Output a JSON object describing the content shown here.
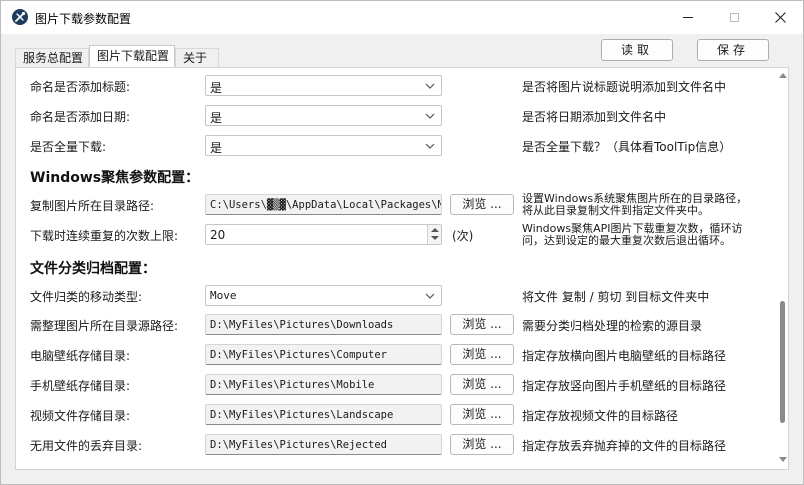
{
  "window": {
    "title": "图片下载参数配置"
  },
  "tabs": [
    {
      "label": "服务总配置"
    },
    {
      "label": "图片下载配置"
    },
    {
      "label": "关于"
    }
  ],
  "actions": {
    "read_label": "读取",
    "save_label": "保存"
  },
  "general": {
    "rows": [
      {
        "label": "命名是否添加标题:",
        "value": "是",
        "desc": "是否将图片说标题说明添加到文件名中"
      },
      {
        "label": "命名是否添加日期:",
        "value": "是",
        "desc": "是否将日期添加到文件名中"
      },
      {
        "label": "是否全量下载:",
        "value": "是",
        "desc": "是否全量下载？（具体看ToolTip信息）"
      }
    ]
  },
  "windows_section": {
    "title": "Windows聚焦参数配置：",
    "copy_path": {
      "label": "复制图片所在目录路径:",
      "value": "C:\\Users\\▓▒▓\\AppData\\Local\\Packages\\Mic",
      "browse": "浏览 ...",
      "desc_line1": "设置Windows系统聚焦图片所在的目录路径，",
      "desc_line2": "将从此目录复制文件到指定文件夹中。"
    },
    "repeat_limit": {
      "label": "下载时连续重复的次数上限:",
      "value": "20",
      "unit": "(次)",
      "desc_line1": "Windows聚焦API图片下载重复次数，循环访",
      "desc_line2": "问，达到设定的最大重复次数后退出循环。"
    }
  },
  "archive_section": {
    "title": "文件分类归档配置：",
    "move_type": {
      "label": "文件归类的移动类型:",
      "value": "Move",
      "desc": "将文件 复制 / 剪切 到目标文件夹中"
    },
    "paths": [
      {
        "label": "需整理图片所在目录源路径:",
        "value": "D:\\MyFiles\\Pictures\\Downloads",
        "browse": "浏览 ...",
        "desc": "需要分类归档处理的检索的源目录"
      },
      {
        "label": "电脑壁纸存储目录:",
        "value": "D:\\MyFiles\\Pictures\\Computer",
        "browse": "浏览 ...",
        "desc": "指定存放横向图片电脑壁纸的目标路径"
      },
      {
        "label": "手机壁纸存储目录:",
        "value": "D:\\MyFiles\\Pictures\\Mobile",
        "browse": "浏览 ...",
        "desc": "指定存放竖向图片手机壁纸的目标路径"
      },
      {
        "label": "视频文件存储目录:",
        "value": "D:\\MyFiles\\Pictures\\Landscape",
        "browse": "浏览 ...",
        "desc": "指定存放视频文件的目标路径"
      },
      {
        "label": "无用文件的丢弃目录:",
        "value": "D:\\MyFiles\\Pictures\\Rejected",
        "browse": "浏览 ...",
        "desc": "指定存放丢弃抛弃掉的文件的目标路径"
      }
    ]
  }
}
